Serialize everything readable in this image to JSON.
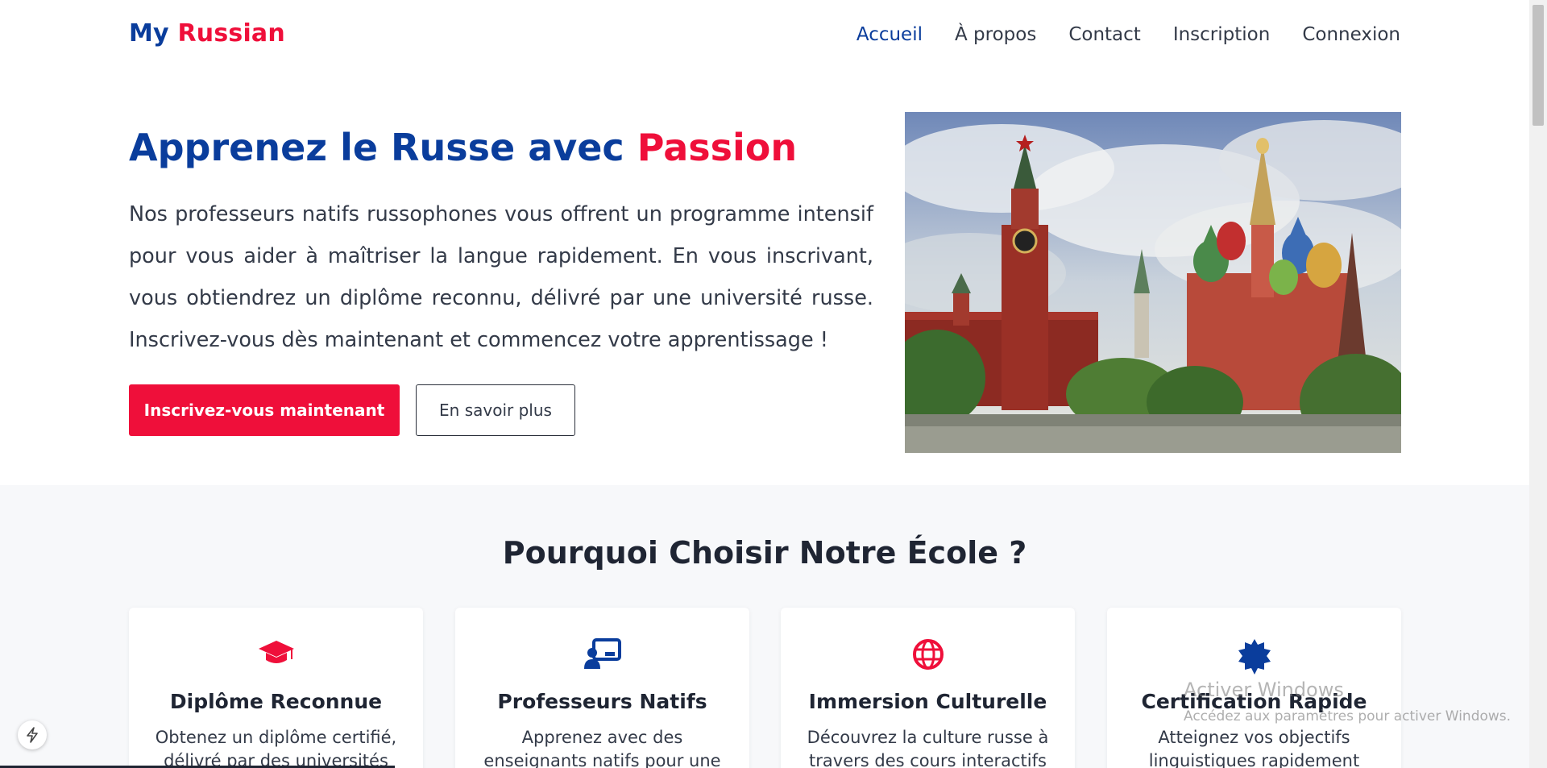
{
  "brand": {
    "part1": "My",
    "part2": "Russian"
  },
  "nav": {
    "items": [
      {
        "label": "Accueil"
      },
      {
        "label": "À propos"
      },
      {
        "label": "Contact"
      },
      {
        "label": "Inscription"
      },
      {
        "label": "Connexion"
      }
    ]
  },
  "hero": {
    "title_main": "Apprenez le Russe avec",
    "title_accent": "Passion",
    "text": "Nos professeurs natifs russophones vous offrent un programme intensif pour vous aider à maîtriser la langue rapidement. En vous inscrivant, vous obtiendrez un diplôme reconnu, délivré par une université russe. Inscrivez-vous dès maintenant et commencez votre apprentissage !",
    "primary_button": "Inscrivez-vous maintenant",
    "secondary_button": "En savoir plus"
  },
  "features": {
    "title": "Pourquoi Choisir Notre École ?",
    "cards": [
      {
        "icon": "graduation-cap-icon",
        "title": "Diplôme Reconnue",
        "text": "Obtenez un diplôme certifié, délivré par des universités"
      },
      {
        "icon": "teacher-icon",
        "title": "Professeurs Natifs",
        "text": "Apprenez avec des enseignants natifs pour une"
      },
      {
        "icon": "globe-icon",
        "title": "Immersion Culturelle",
        "text": "Découvrez la culture russe à travers des cours interactifs et"
      },
      {
        "icon": "certificate-icon",
        "title": "Certification Rapide",
        "text": "Atteignez vos objectifs linguistiques rapidement avec"
      }
    ]
  },
  "watermark": {
    "line1": "Activer Windows",
    "line2": "Accédez aux paramètres pour activer Windows."
  },
  "colors": {
    "primary_blue": "#0a3d9c",
    "accent_red": "#ef0f3a",
    "section_bg": "#f7f8fa"
  }
}
